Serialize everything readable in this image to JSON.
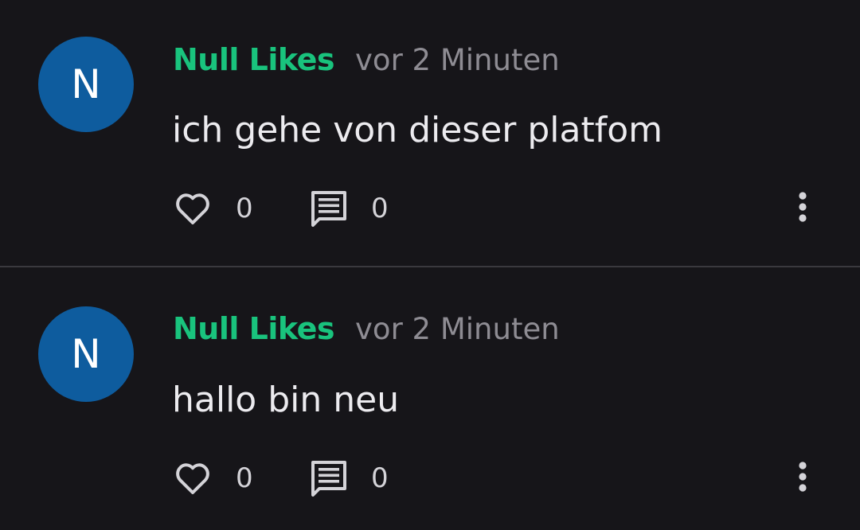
{
  "colors": {
    "background": "#161519",
    "username": "#19c37d",
    "avatar": "#0e5c9e",
    "icon": "#d4d3d8"
  },
  "comments": [
    {
      "avatar_letter": "N",
      "username": "Null Likes",
      "time": "vor 2 Minuten",
      "text": "ich gehe von dieser platfom",
      "likes": "0",
      "replies": "0",
      "icons": {
        "like": "heart-outline-icon",
        "reply": "comment-icon",
        "more": "more-vertical-icon"
      }
    },
    {
      "avatar_letter": "N",
      "username": "Null Likes",
      "time": "vor 2 Minuten",
      "text": "hallo bin neu",
      "likes": "0",
      "replies": "0",
      "icons": {
        "like": "heart-outline-icon",
        "reply": "comment-icon",
        "more": "more-vertical-icon"
      }
    }
  ]
}
